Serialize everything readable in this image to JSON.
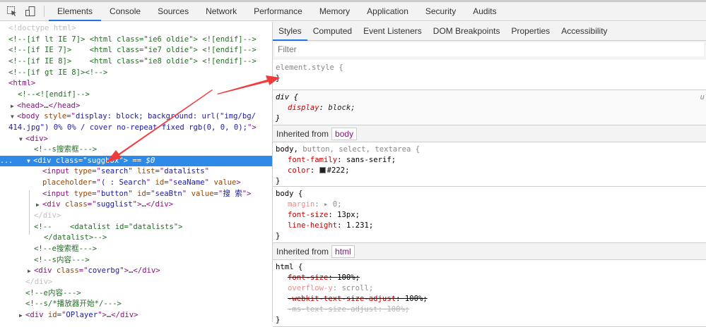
{
  "toolbar": {
    "tabs": [
      "Elements",
      "Console",
      "Sources",
      "Network",
      "Performance",
      "Memory",
      "Application",
      "Security",
      "Audits"
    ],
    "active": "Elements"
  },
  "dom": {
    "lines": [
      {
        "indent": 12,
        "tokens": [
          [
            "dt",
            "<!doctype html>"
          ]
        ]
      },
      {
        "indent": 12,
        "tokens": [
          [
            "com",
            "<!--[if lt IE 7]> <html class=\"ie6 oldie\"> <![endif]-->"
          ]
        ]
      },
      {
        "indent": 12,
        "tokens": [
          [
            "com",
            "<!--[if IE 7]>    <html class=\"ie7 oldie\"> <![endif]-->"
          ]
        ]
      },
      {
        "indent": 12,
        "tokens": [
          [
            "com",
            "<!--[if IE 8]>    <html class=\"ie8 oldie\"> <![endif]-->"
          ]
        ]
      },
      {
        "indent": 12,
        "tokens": [
          [
            "com",
            "<!--[if gt IE 8]><!-->"
          ]
        ]
      },
      {
        "indent": 12,
        "tokens": [
          [
            "tag",
            "<html>"
          ]
        ]
      },
      {
        "indent": 25,
        "tokens": [
          [
            "com",
            "<!--<![endif]-->"
          ]
        ]
      },
      {
        "indent": 15,
        "tri": "▶",
        "tokens": [
          [
            "tag",
            "<head>"
          ],
          [
            "txt",
            "…"
          ],
          [
            "tag",
            "</head>"
          ]
        ]
      },
      {
        "indent": 15,
        "tri": "▼",
        "tokens": [
          [
            "tag",
            "<body "
          ],
          [
            "attr",
            "style"
          ],
          [
            "tag",
            "=\""
          ],
          [
            "val",
            "display: block; background: url(\"img/bg/"
          ]
        ]
      },
      {
        "indent": 12,
        "tokens": [
          [
            "val",
            "414.jpg\") 0% 0% / cover no-repeat fixed rgb(0, 0, 0);"
          ],
          [
            "tag",
            "\">"
          ]
        ]
      },
      {
        "indent": 27,
        "tri": "▼",
        "tokens": [
          [
            "tag",
            "<div>"
          ]
        ]
      },
      {
        "indent": 48,
        "tokens": [
          [
            "com",
            "<!--s搜索框--->"
          ]
        ]
      },
      {
        "indent": 38,
        "tri": "▼",
        "sel": true,
        "tokens": [
          [
            "tag",
            "<div "
          ],
          [
            "attr",
            "class"
          ],
          [
            "tag",
            "=\""
          ],
          [
            "val",
            "suggbox"
          ],
          [
            "tag",
            "\">"
          ],
          [
            "gray",
            " == $0"
          ]
        ]
      },
      {
        "indent": 60,
        "tokens": [
          [
            "tag",
            "<input "
          ],
          [
            "attr",
            "type"
          ],
          [
            "tag",
            "=\""
          ],
          [
            "val",
            "search"
          ],
          [
            "tag",
            "\" "
          ],
          [
            "attr",
            "list"
          ],
          [
            "tag",
            "=\""
          ],
          [
            "val",
            "datalists"
          ],
          [
            "tag",
            "\""
          ]
        ]
      },
      {
        "indent": 60,
        "tokens": [
          [
            "attr",
            "placeholder"
          ],
          [
            "tag",
            "=\""
          ],
          [
            "val",
            "( : Search"
          ],
          [
            "tag",
            "\" "
          ],
          [
            "attr",
            "id"
          ],
          [
            "tag",
            "=\""
          ],
          [
            "val",
            "seaName"
          ],
          [
            "tag",
            "\" "
          ],
          [
            "attr",
            "value"
          ],
          [
            "tag",
            ">"
          ]
        ]
      },
      {
        "indent": 60,
        "tokens": [
          [
            "tag",
            "<input "
          ],
          [
            "attr",
            "type"
          ],
          [
            "tag",
            "=\""
          ],
          [
            "val",
            "button"
          ],
          [
            "tag",
            "\" "
          ],
          [
            "attr",
            "id"
          ],
          [
            "tag",
            "=\""
          ],
          [
            "val",
            "seaBtn"
          ],
          [
            "tag",
            "\" "
          ],
          [
            "attr",
            "value"
          ],
          [
            "tag",
            "=\""
          ],
          [
            "val",
            "搜 索"
          ],
          [
            "tag",
            "\">"
          ]
        ]
      },
      {
        "indent": 51,
        "tri": "▶",
        "tokens": [
          [
            "tag",
            "<div "
          ],
          [
            "attr",
            "class"
          ],
          [
            "tag",
            "=\""
          ],
          [
            "val",
            "sugglist"
          ],
          [
            "tag",
            "\">"
          ],
          [
            "txt",
            "…"
          ],
          [
            "tag",
            "</div>"
          ]
        ]
      },
      {
        "indent": 48,
        "tokens": [
          [
            "dt",
            "</div>"
          ]
        ]
      },
      {
        "indent": 48,
        "tokens": [
          [
            "com",
            "<!--    <datalist id=\"datalists\">"
          ]
        ]
      },
      {
        "indent": 62,
        "tokens": [
          [
            "com",
            "</datalist>-->"
          ]
        ]
      },
      {
        "indent": 48,
        "tokens": [
          [
            "com",
            "<!--e搜索框--->"
          ]
        ]
      },
      {
        "indent": 48,
        "tokens": [
          [
            "com",
            "<!--s内容--->"
          ]
        ]
      },
      {
        "indent": 39,
        "tri": "▶",
        "tokens": [
          [
            "tag",
            "<div "
          ],
          [
            "attr",
            "class"
          ],
          [
            "tag",
            "=\""
          ],
          [
            "val",
            "coverbg"
          ],
          [
            "tag",
            "\">"
          ],
          [
            "txt",
            "…"
          ],
          [
            "tag",
            "</div>"
          ]
        ]
      },
      {
        "indent": 36,
        "tokens": [
          [
            "dt",
            "</div>"
          ]
        ]
      },
      {
        "indent": 36,
        "tokens": [
          [
            "com",
            "<!--e内容--->"
          ]
        ]
      },
      {
        "indent": 36,
        "tokens": [
          [
            "com",
            "<!--s/*播放器开始*/--->"
          ]
        ]
      },
      {
        "indent": 27,
        "tri": "▶",
        "tokens": [
          [
            "tag",
            "<div "
          ],
          [
            "attr",
            "id"
          ],
          [
            "tag",
            "=\""
          ],
          [
            "val",
            "OPlayer"
          ],
          [
            "tag",
            "\">"
          ],
          [
            "txt",
            "…"
          ],
          [
            "tag",
            "</div>"
          ]
        ]
      }
    ],
    "dots": "..."
  },
  "styles": {
    "tabs": [
      "Styles",
      "Computed",
      "Event Listeners",
      "DOM Breakpoints",
      "Properties",
      "Accessibility"
    ],
    "filter_placeholder": "Filter",
    "element_style": {
      "selector": "element.style {",
      "close": "}"
    },
    "div_rule": {
      "selector": "div {",
      "prop": "display",
      "value": "block;",
      "close": "}",
      "source": "u"
    },
    "inherited_body": {
      "label": "Inherited from",
      "badge": "body"
    },
    "rule1": {
      "selector_main": "body,",
      "selector_rest": " button, select, textarea {",
      "props": [
        {
          "name": "font-family",
          "value": "sans-serif;"
        },
        {
          "name": "color",
          "value": "#222;"
        }
      ],
      "close": "}"
    },
    "rule2": {
      "selector": "body {",
      "props": [
        {
          "name": "margin",
          "value": "▸ 0;"
        },
        {
          "name": "font-size",
          "value": "13px;"
        },
        {
          "name": "line-height",
          "value": "1.231;"
        }
      ],
      "close": "}"
    },
    "inherited_html": {
      "label": "Inherited from",
      "badge": "html"
    },
    "rule3": {
      "selector": "html {",
      "props": [
        {
          "name": "font-size",
          "value": "100%;"
        },
        {
          "name": "overflow-y",
          "value": "scroll;"
        },
        {
          "name": "-webkit-text-size-adjust",
          "value": "100%;"
        },
        {
          "name": "-ms-text-size-adjust",
          "value": "100%;"
        }
      ],
      "close": "}"
    }
  },
  "colors": {
    "accent": "#1a73e8",
    "selection": "#2e8ae6",
    "arrow": "#f03c3c"
  }
}
